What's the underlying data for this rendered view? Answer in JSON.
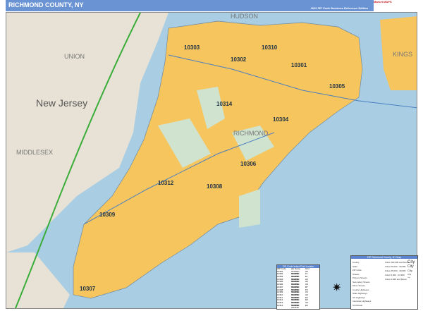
{
  "header": {
    "title": "RICHMOND COUNTY, NY",
    "subtitle": "2020 ZIP Code Business Reference Edition",
    "logo": "Market MAPS"
  },
  "map": {
    "region_labels": [
      "HUDSON",
      "UNION",
      "KINGS",
      "New Jersey",
      "MIDDLESEX",
      "RICHMOND"
    ],
    "zip_labels": [
      "10303",
      "10302",
      "10310",
      "10301",
      "10305",
      "10314",
      "10304",
      "10306",
      "10312",
      "10308",
      "10309",
      "10307"
    ],
    "colors": {
      "water": "#a9cde3",
      "land": "#e8e2d6",
      "county": "#f7c55e",
      "park": "#cfe3cf",
      "highway": "#3aad3a"
    }
  },
  "zip_table": {
    "title": "ZIP Code Index/Grid Locator",
    "headers": [
      "ZIP Code",
      "Zip Name",
      "Grid"
    ],
    "rows": [
      [
        "10301",
        "STATEN ISLAND",
        "H3"
      ],
      [
        "10302",
        "STATEN ISLAND",
        "F1"
      ],
      [
        "10303",
        "STATEN ISLAND",
        "E1"
      ],
      [
        "10304",
        "STATEN ISLAND",
        "H3"
      ],
      [
        "10305",
        "STATEN ISLAND",
        "H3"
      ],
      [
        "10306",
        "STATEN ISLAND",
        "G5"
      ],
      [
        "10307",
        "STATEN ISLAND",
        "B7"
      ],
      [
        "10308",
        "STATEN ISLAND",
        "F5"
      ],
      [
        "10309",
        "STATEN ISLAND",
        "C6"
      ],
      [
        "10310",
        "STATEN ISLAND",
        "G2"
      ],
      [
        "10311",
        "STATEN ISLAND",
        "E2"
      ],
      [
        "10312",
        "STATEN ISLAND",
        "E5"
      ],
      [
        "10313",
        "STATEN ISLAND",
        "G2"
      ],
      [
        "10314",
        "STATEN ISLAND",
        "E3"
      ]
    ]
  },
  "legend": {
    "title": "ZIP Richmond County, NY Map",
    "items": [
      "County",
      "State",
      "ZIP Code",
      "Streets",
      "Primary Streets",
      "Secondary Streets",
      "Minor Streets",
      "County Highways",
      "State Highways",
      "US Highways",
      "Interstate Highways",
      "Toll Roads"
    ],
    "cities": [
      "Cities 100,000 and Above",
      "Cities 50,000 - 99,999",
      "Cities 25,000 - 49,999",
      "Cities 5,000 - 24,999",
      "Cities 0-999 and Below"
    ],
    "city_label": "City"
  }
}
